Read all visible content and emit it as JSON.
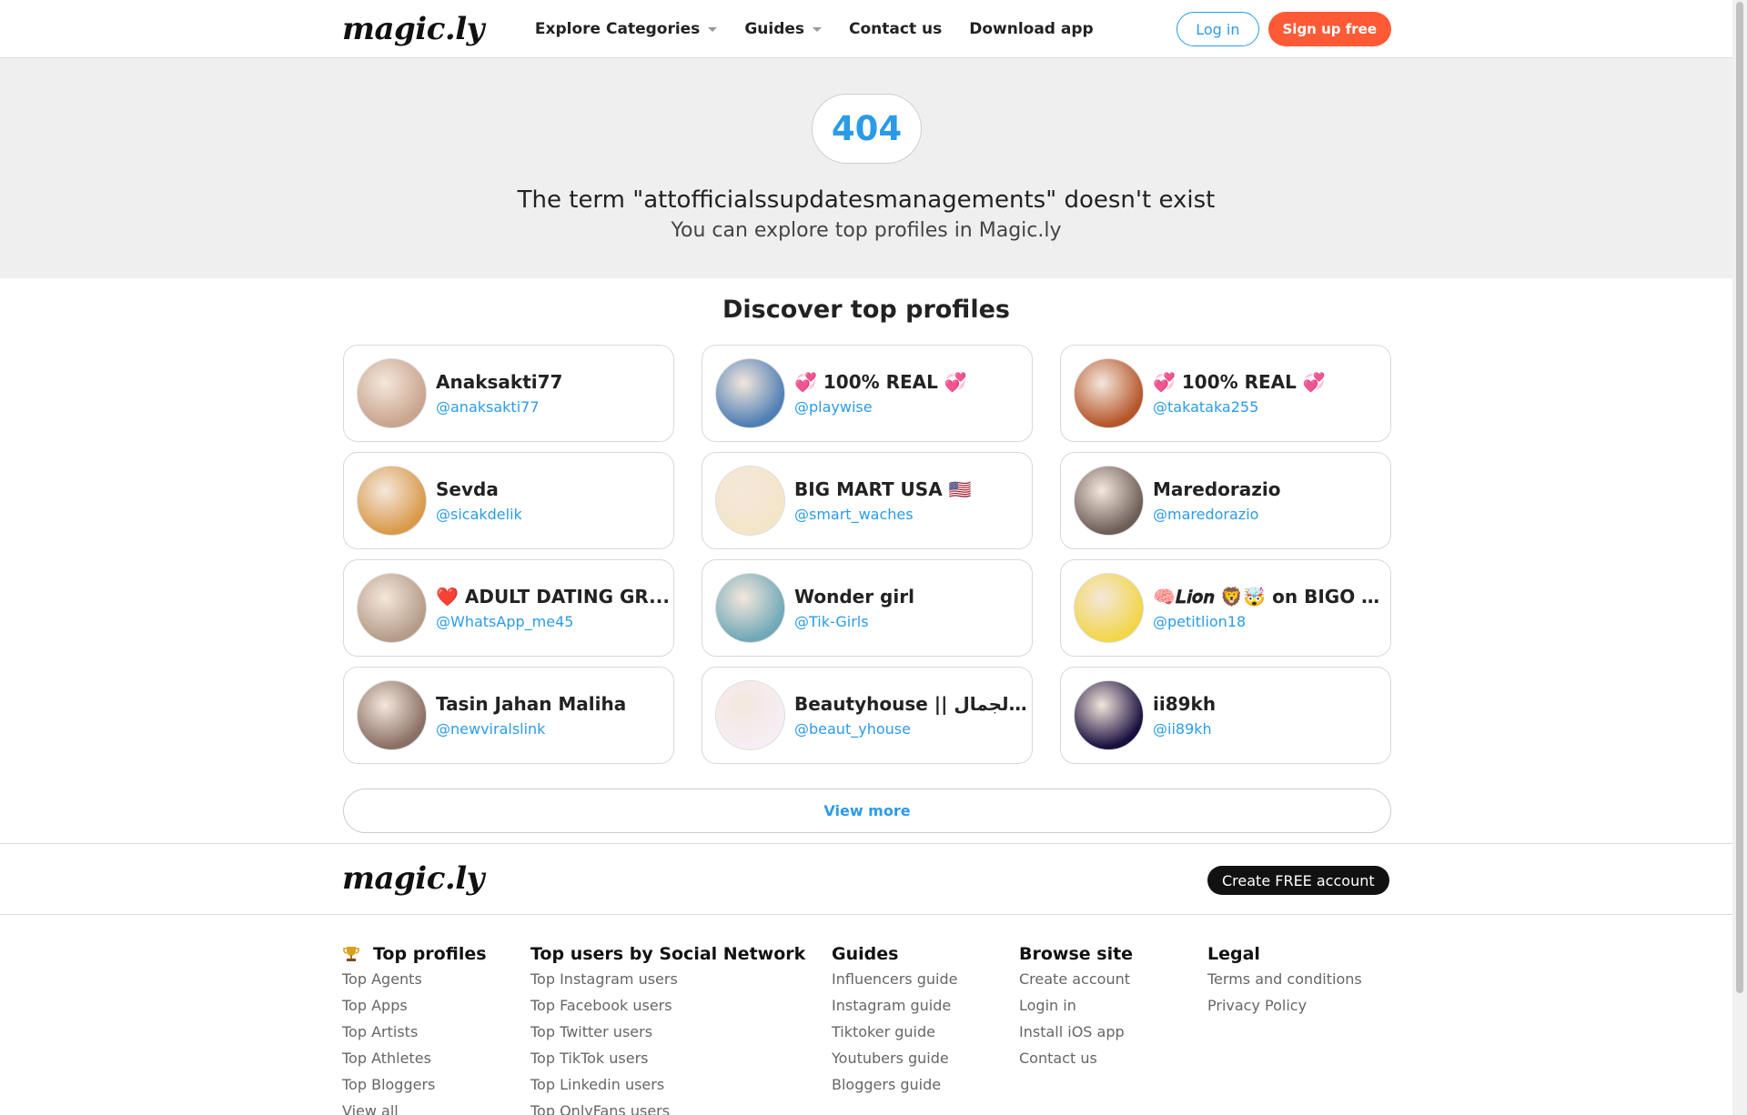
{
  "header": {
    "logo": "magic.ly",
    "nav": [
      {
        "label": "Explore Categories",
        "dropdown": true
      },
      {
        "label": "Guides",
        "dropdown": true
      },
      {
        "label": "Contact us",
        "dropdown": false
      },
      {
        "label": "Download app",
        "dropdown": false
      }
    ],
    "login_label": "Log in",
    "signup_label": "Sign up free"
  },
  "hero": {
    "code": "404",
    "title": "The term \"attofficialssupdatesmanagements\" doesn't exist",
    "subtitle": "You can explore top profiles in Magic.ly"
  },
  "discover": {
    "title": "Discover top profiles",
    "profiles": [
      {
        "name": "Anaksakti77",
        "handle": "@anaksakti77",
        "avatar_color": "#c9a48e"
      },
      {
        "name": "💞 100% REAL 💞",
        "handle": "@playwise",
        "avatar_color": "#4f7fb5"
      },
      {
        "name": "💞 100% REAL 💞",
        "handle": "@takataka255",
        "avatar_color": "#b5562a"
      },
      {
        "name": "Sevda",
        "handle": "@sicakdelik",
        "avatar_color": "#d99a4a"
      },
      {
        "name": "BIG MART USA 🇺🇸",
        "handle": "@smart_waches",
        "avatar_color": "#f3e6c8"
      },
      {
        "name": "Maredorazio",
        "handle": "@maredorazio",
        "avatar_color": "#6e5e58"
      },
      {
        "name": "❤️ ADULT DATING GR...",
        "handle": "@WhatsApp_me45",
        "avatar_color": "#b59c88"
      },
      {
        "name": "Wonder girl",
        "handle": "@Tik-Girls",
        "avatar_color": "#6fa9b8"
      },
      {
        "name": "🧠𝑳𝒊𝒐𝒏 🦁🤯 on BIGO L...",
        "handle": "@petitlion18",
        "avatar_color": "#f2d64a"
      },
      {
        "name": "Tasin Jahan Maliha",
        "handle": "@newviralslink",
        "avatar_color": "#8a6f64"
      },
      {
        "name": "Beautyhouse || الجمال ...",
        "handle": "@beaut_yhouse",
        "avatar_color": "#f6eef5"
      },
      {
        "name": "ii89kh",
        "handle": "@ii89kh",
        "avatar_color": "#1a1040"
      }
    ],
    "view_more": "View more"
  },
  "footer": {
    "logo": "magic.ly",
    "create_label": "Create FREE account",
    "columns": [
      {
        "title": "Top profiles",
        "icon": "trophy-icon",
        "links": [
          "Top Agents",
          "Top Apps",
          "Top Artists",
          "Top Athletes",
          "Top Bloggers",
          "View all"
        ]
      },
      {
        "title": "Top users by Social Network",
        "links": [
          "Top Instagram users",
          "Top Facebook users",
          "Top Twitter users",
          "Top TikTok users",
          "Top Linkedin users",
          "Top OnlyFans users"
        ]
      },
      {
        "title": "Guides",
        "links": [
          "Influencers guide",
          "Instagram guide",
          "Tiktoker guide",
          "Youtubers guide",
          "Bloggers guide"
        ]
      },
      {
        "title": "Browse site",
        "links": [
          "Create account",
          "Login in",
          "Install iOS app",
          "Contact us"
        ]
      },
      {
        "title": "Legal",
        "links": [
          "Terms and conditions",
          "Privacy Policy"
        ]
      }
    ]
  },
  "colors": {
    "accent": "#2b9be8",
    "signup": "#ff5a36",
    "hero_bg": "#efefef"
  }
}
